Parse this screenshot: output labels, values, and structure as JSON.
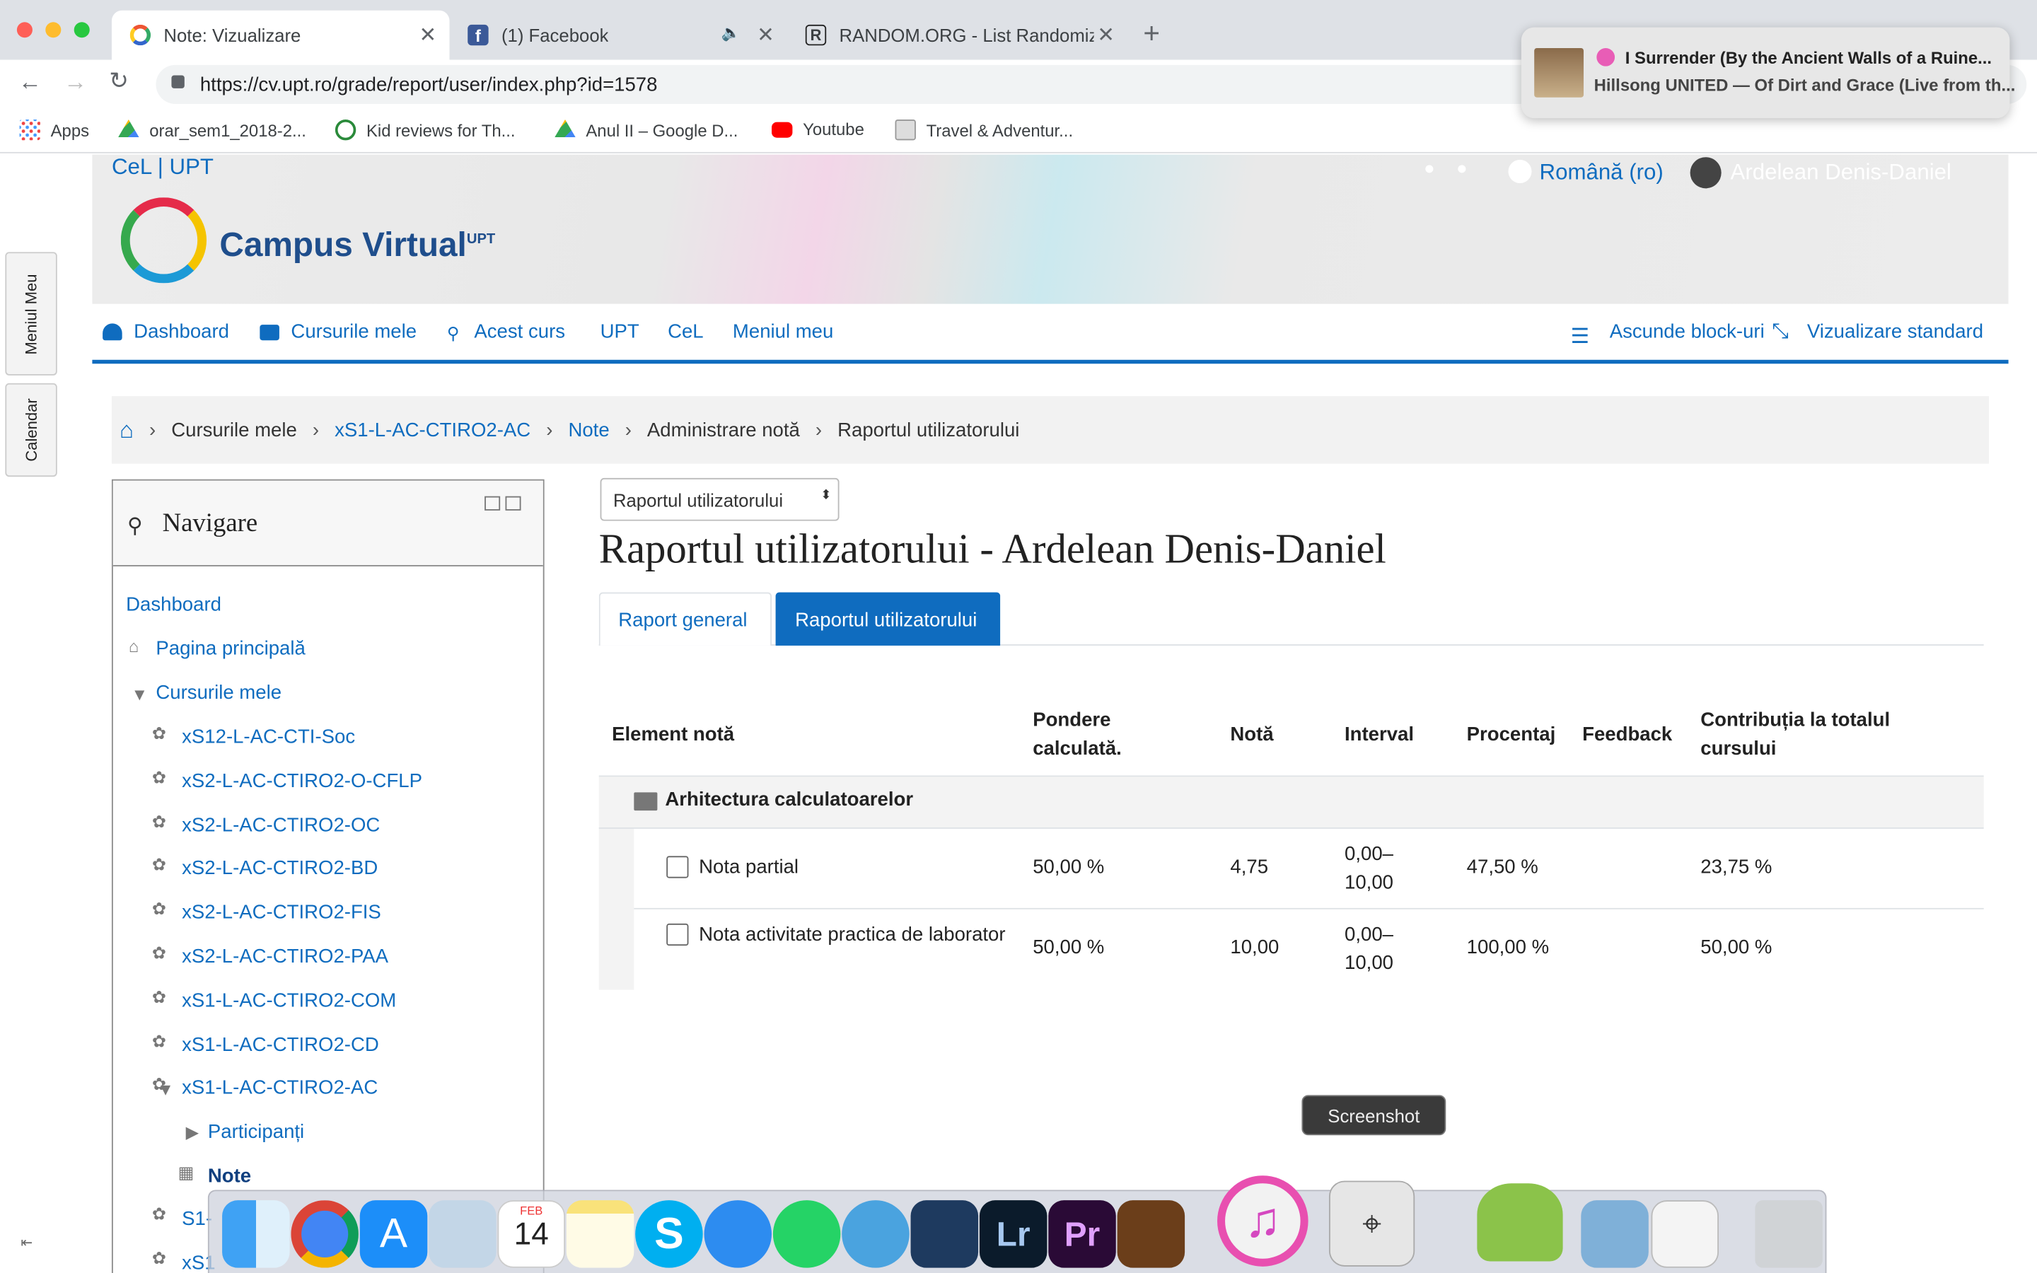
{
  "browser": {
    "tabs": [
      {
        "title": "Note: Vizualizare"
      },
      {
        "title": "(1) Facebook"
      },
      {
        "title": "RANDOM.ORG - List Randomiz"
      }
    ],
    "new_tab": "+",
    "url": "https://cv.upt.ro/grade/report/user/index.php?id=1578",
    "bookmarks": [
      {
        "label": "Apps"
      },
      {
        "label": "orar_sem1_2018-2..."
      },
      {
        "label": "Kid reviews for Th..."
      },
      {
        "label": "Anul II – Google D..."
      },
      {
        "label": "Youtube"
      },
      {
        "label": "Travel & Adventur..."
      }
    ]
  },
  "notification": {
    "title": "I Surrender (By the Ancient Walls of a Ruine...",
    "subtitle": "Hillsong UNITED — Of Dirt and Grace (Live from th..."
  },
  "site": {
    "brand_link": "CeL | UPT",
    "logo_text": "Campus Virtual",
    "logo_sup": "UPT",
    "language": "Română (ro)",
    "user_name": "Ardelean Denis-Daniel"
  },
  "navbar": {
    "items": [
      "Dashboard",
      "Cursurile mele",
      "Acest curs",
      "UPT",
      "CeL",
      "Meniul meu"
    ],
    "hide_blocks": "Ascunde block-uri",
    "standard_view": "Vizualizare standard"
  },
  "side_tabs": [
    "Meniul Meu",
    "Calendar"
  ],
  "breadcrumb": [
    "Cursurile mele",
    "xS1-L-AC-CTIRO2-AC",
    "Note",
    "Administrare notă",
    "Raportul utilizatorului"
  ],
  "navigation_block": {
    "title": "Navigare",
    "dashboard": "Dashboard",
    "home": "Pagina principală",
    "my_courses": "Cursurile mele",
    "courses": [
      "xS12-L-AC-CTI-Soc",
      "xS2-L-AC-CTIRO2-O-CFLP",
      "xS2-L-AC-CTIRO2-OC",
      "xS2-L-AC-CTIRO2-BD",
      "xS2-L-AC-CTIRO2-FIS",
      "xS2-L-AC-CTIRO2-PAA",
      "xS1-L-AC-CTIRO2-COM",
      "xS1-L-AC-CTIRO2-CD",
      "xS1-L-AC-CTIRO2-AC"
    ],
    "participants": "Participanți",
    "grades": "Note",
    "cut_1": "S1-",
    "cut_2": "xS1"
  },
  "report": {
    "select_value": "Raportul utilizatorului",
    "heading": "Raportul utilizatorului - Ardelean Denis-Daniel",
    "tabs": [
      "Raport general",
      "Raportul utilizatorului"
    ],
    "columns": [
      "Element notă",
      "Pondere calculată.",
      "Notă",
      "Interval",
      "Procentaj",
      "Feedback",
      "Contribuția la totalul cursului"
    ],
    "category": "Arhitectura calculatoarelor",
    "rows": [
      {
        "item": "Nota partial",
        "weight": "50,00 %",
        "grade": "4,75",
        "range": "0,00–10,00",
        "percent": "47,50 %",
        "feedback": "",
        "contribution": "23,75 %"
      },
      {
        "item": "Nota activitate practica de laborator",
        "weight": "50,00 %",
        "grade": "10,00",
        "range": "0,00–10,00",
        "percent": "100,00 %",
        "feedback": "",
        "contribution": "50,00 %"
      }
    ]
  },
  "dock": {
    "tooltip": "Screenshot",
    "calendar_month": "FEB",
    "calendar_day": "14"
  }
}
